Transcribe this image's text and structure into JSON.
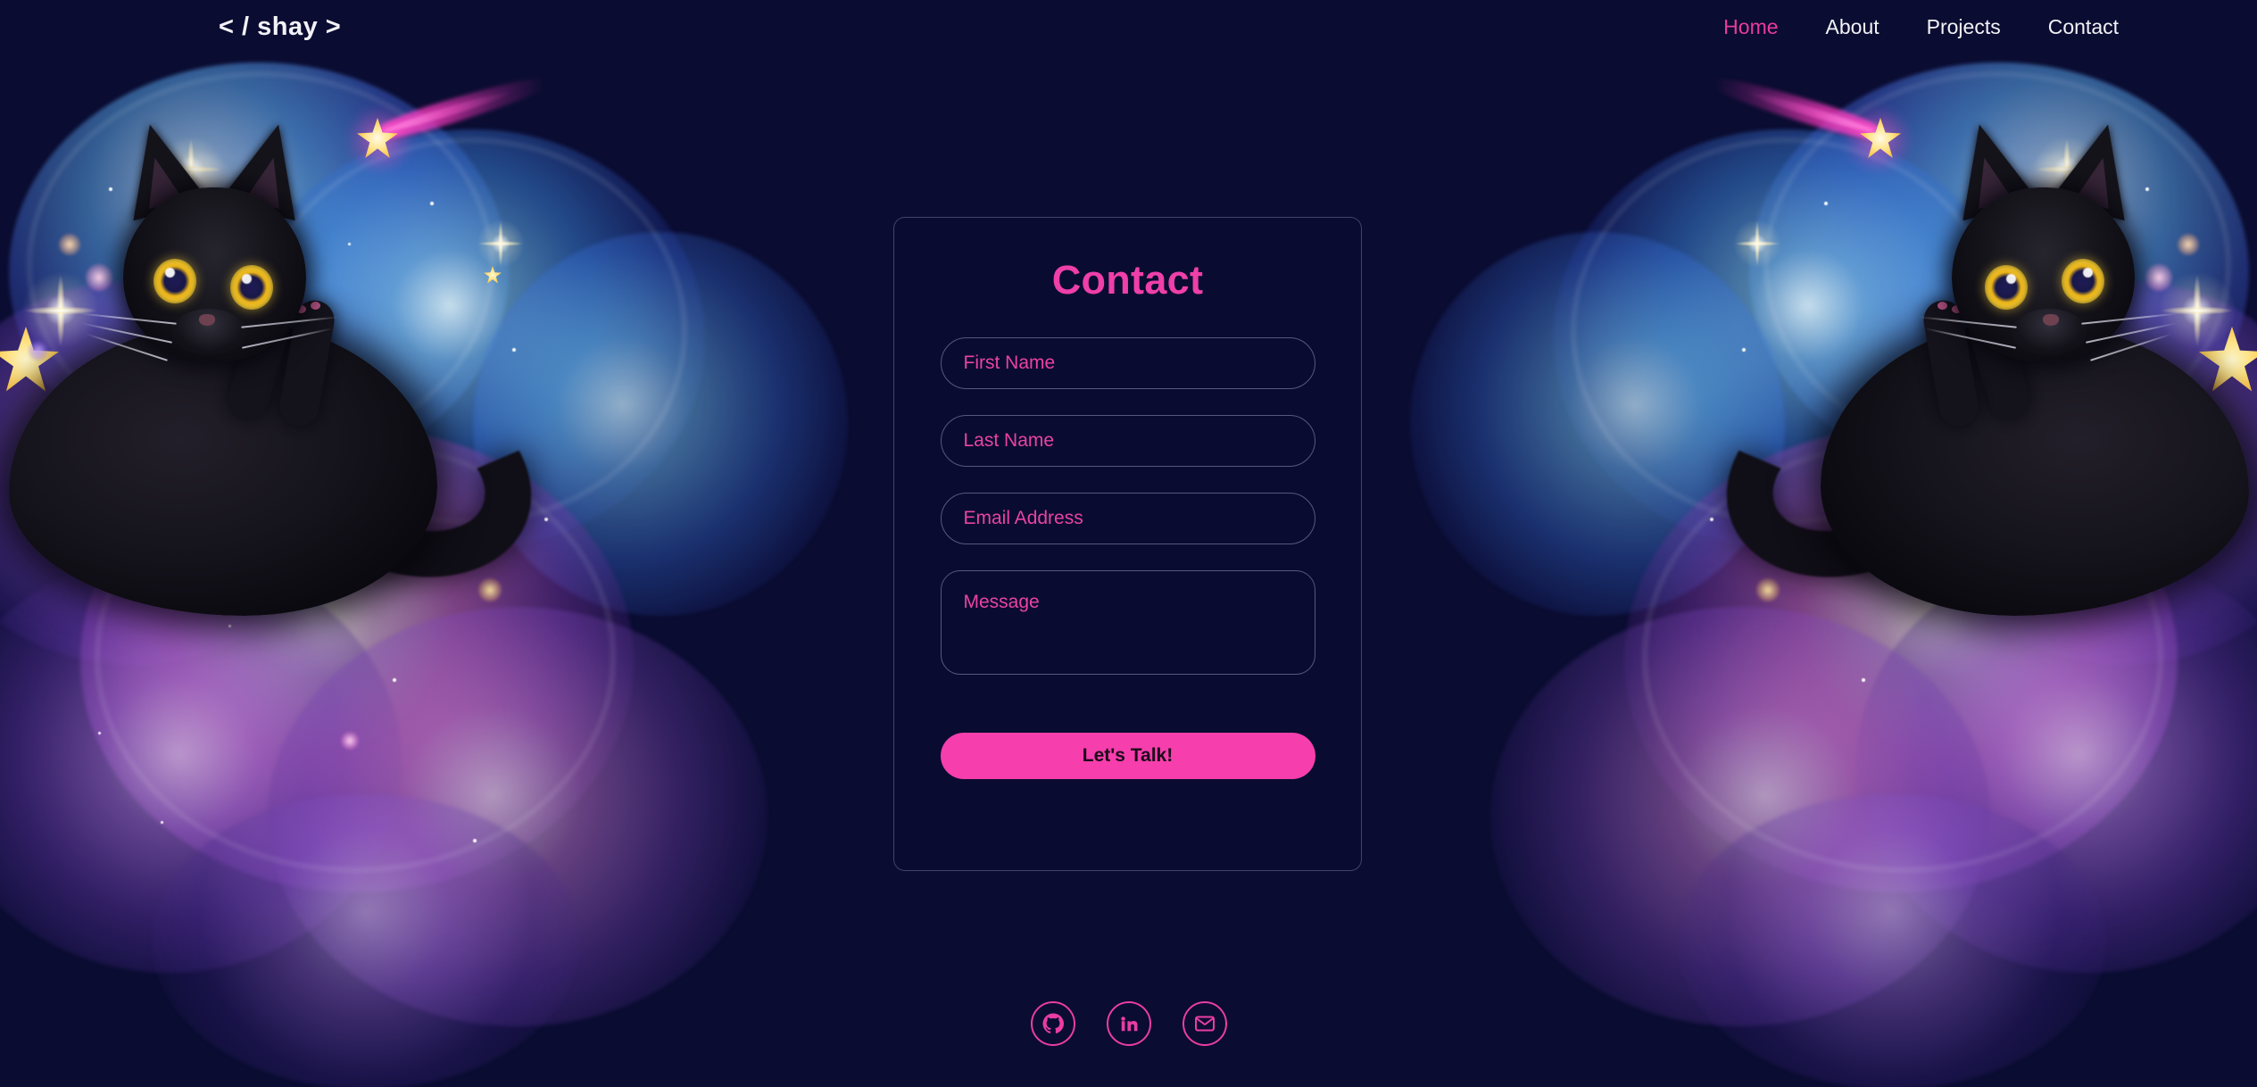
{
  "header": {
    "logo": "< / shay >",
    "nav": [
      {
        "label": "Home",
        "active": true
      },
      {
        "label": "About",
        "active": false
      },
      {
        "label": "Projects",
        "active": false
      },
      {
        "label": "Contact",
        "active": false
      }
    ]
  },
  "contact_form": {
    "title": "Contact",
    "fields": [
      {
        "name": "first-name",
        "placeholder": "First Name",
        "value": ""
      },
      {
        "name": "last-name",
        "placeholder": "Last Name",
        "value": ""
      },
      {
        "name": "email-address",
        "placeholder": "Email Address",
        "value": ""
      },
      {
        "name": "message",
        "placeholder": "Message",
        "value": ""
      }
    ],
    "submit_label": "Let's Talk!"
  },
  "social": [
    {
      "icon": "github-icon",
      "label": "GitHub"
    },
    {
      "icon": "linkedin-icon",
      "label": "LinkedIn"
    },
    {
      "icon": "email-icon",
      "label": "Email"
    }
  ],
  "artwork": {
    "description": "Black cat lounging on a cosmic nebula cloud with stars and a pink comet",
    "comet_label": "shooting-star"
  },
  "colors": {
    "background": "#0a0c31",
    "accent_pink": "#ef3fa9",
    "button_pink": "#f63ead",
    "nav_text": "#f2f2f7",
    "panel_border": "rgba(190,190,225,0.32)"
  }
}
